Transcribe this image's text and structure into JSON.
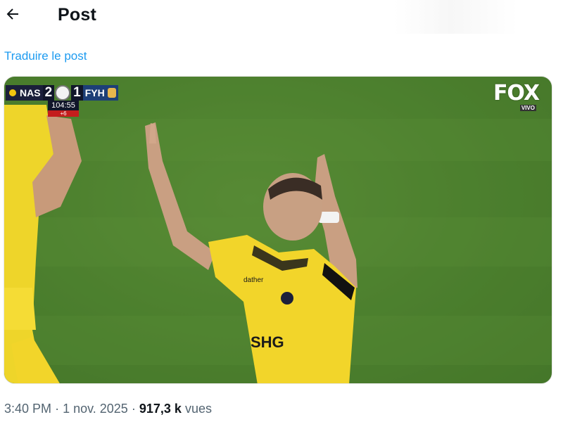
{
  "header": {
    "title": "Post",
    "back_icon": "arrow-left-icon"
  },
  "translate_link": "Traduire le post",
  "media": {
    "scoreboard": {
      "home_team": "NAS",
      "home_score": "2",
      "away_score": "1",
      "away_team": "FYH",
      "clock": "104:55",
      "added_time": "+6"
    },
    "broadcaster": "FOX",
    "broadcaster_sub": "VIVO",
    "shirt_sponsor": "SHG",
    "shirt_brand": "dather"
  },
  "meta": {
    "time": "3:40 PM",
    "separator_1": "·",
    "date": "1 nov. 2025",
    "separator_2": "·",
    "views_count": "917,3 k",
    "views_label": "vues"
  },
  "colors": {
    "accent": "#1d9bf0",
    "muted_text": "#536471",
    "pitch": "#4a7d2e",
    "kit_yellow": "#f2d52a"
  }
}
